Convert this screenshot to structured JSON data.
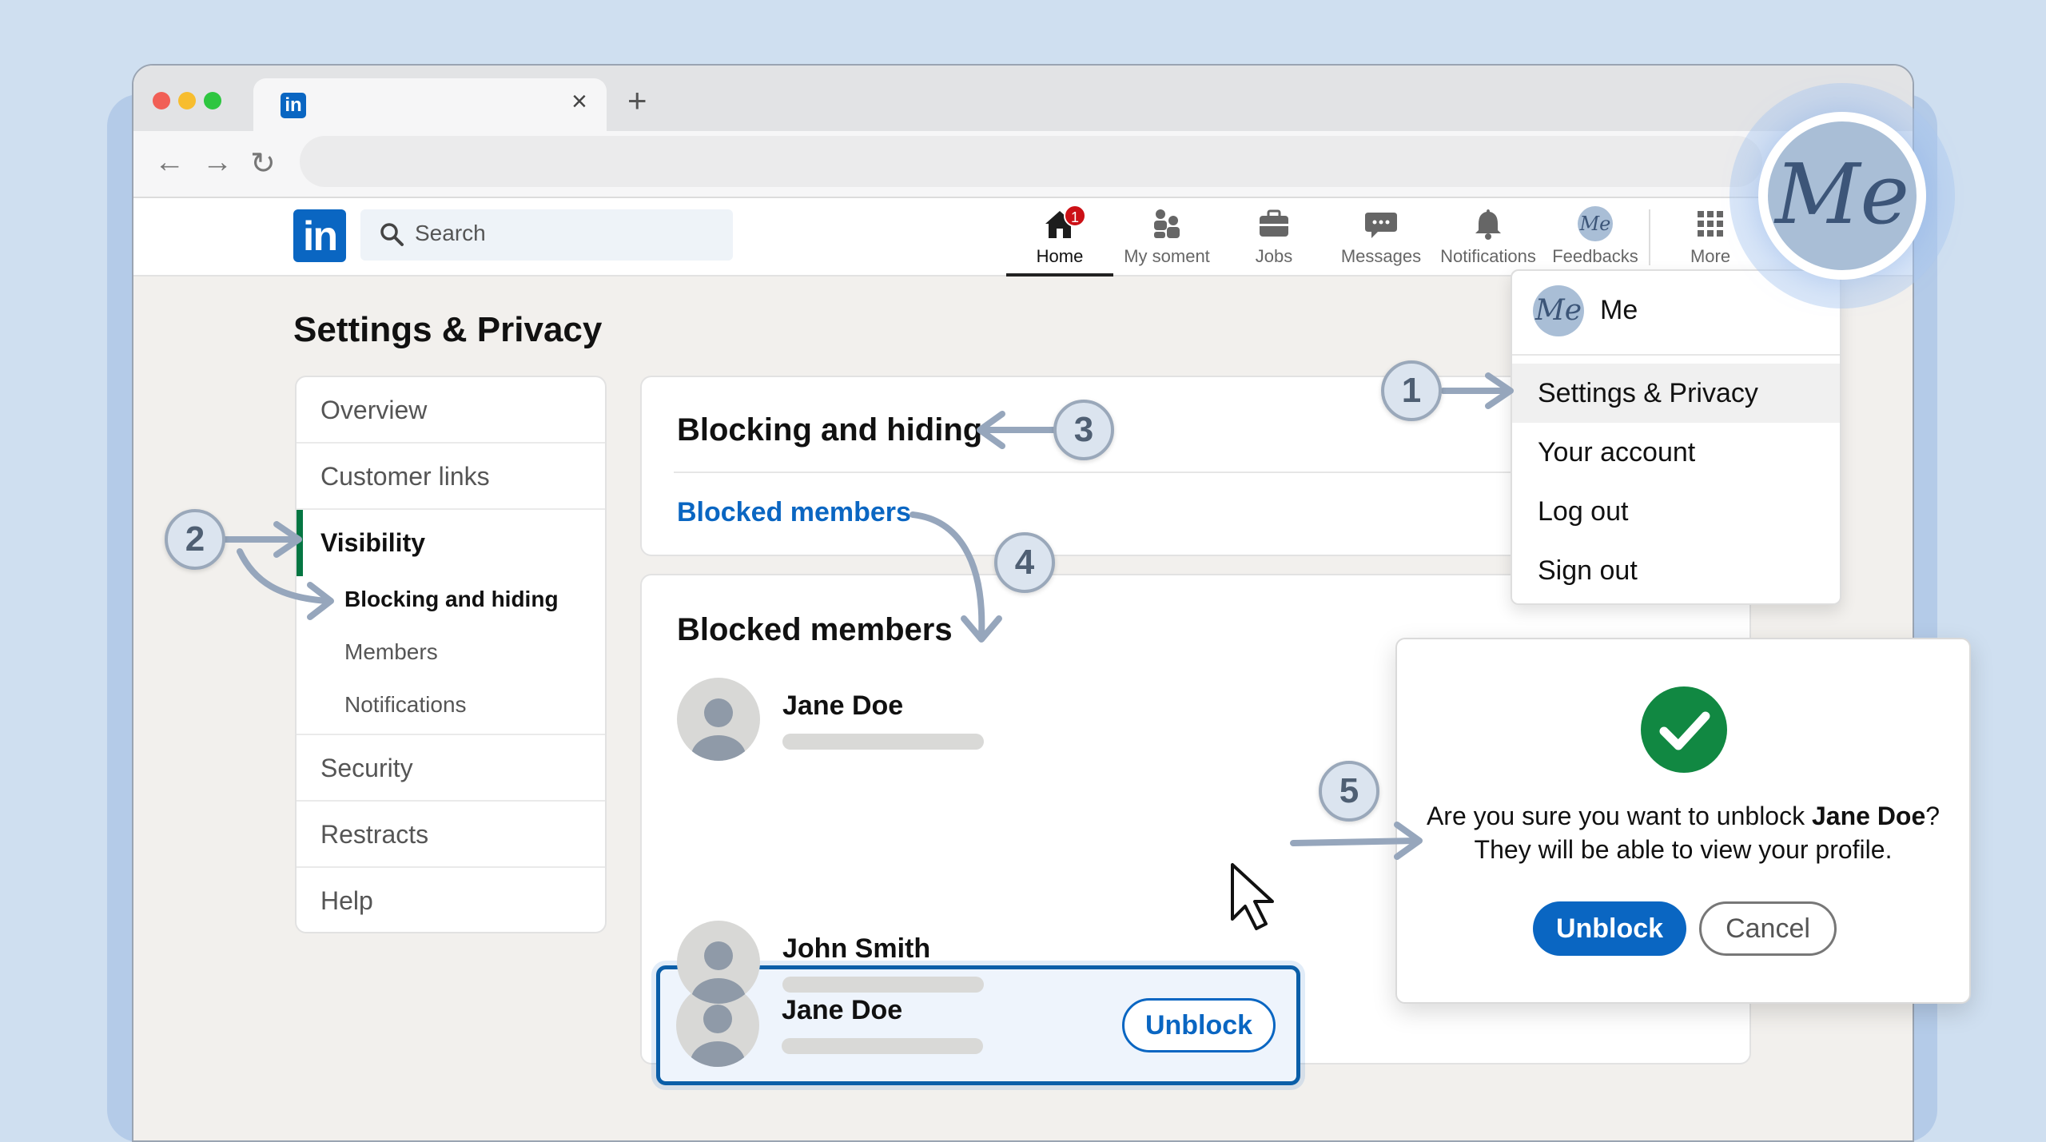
{
  "browser": {
    "tab_favicon": "in",
    "tab_close": "×",
    "new_tab": "+",
    "nav_back": "←",
    "nav_forward": "→",
    "nav_reload": "↻"
  },
  "linkedin": {
    "logo": "in",
    "search_placeholder": "Search",
    "nav": [
      {
        "label": "Home",
        "icon": "home-icon",
        "badge": "1"
      },
      {
        "label": "My soment",
        "icon": "my-network-icon"
      },
      {
        "label": "Jobs",
        "icon": "briefcase-icon"
      },
      {
        "label": "Messages",
        "icon": "message-icon"
      },
      {
        "label": "Notifications",
        "icon": "bell-icon"
      },
      {
        "label": "Feedbacks",
        "icon": "me-avatar-icon",
        "avatar_text": "Me"
      },
      {
        "label": "More",
        "icon": "grid-icon"
      }
    ]
  },
  "page_title": "Settings & Privacy",
  "sidebar": {
    "items": [
      "Overview",
      "Customer links",
      "Visibility",
      "Security",
      "Restracts",
      "Help"
    ],
    "sub_items": [
      "Blocking and hiding",
      "Members",
      "Notifications"
    ]
  },
  "blocking_card": {
    "title": "Blocking and hiding",
    "link": "Blocked members"
  },
  "blocked_card": {
    "title": "Blocked members",
    "members": [
      {
        "name": "Jane Doe"
      },
      {
        "name": "Jane Doe",
        "action": "Unblock"
      },
      {
        "name": "John Smith"
      }
    ]
  },
  "me_menu": {
    "avatar_text": "Me",
    "name": "Me",
    "items": [
      "Settings & Privacy",
      "Your account",
      "Log out",
      "Sign out"
    ]
  },
  "me_bubble": "Me",
  "modal": {
    "question_prefix": "Are you sure you want to unblock ",
    "question_name": "Jane Doe",
    "question_suffix": "?",
    "line2": "They will be able to view your profile.",
    "confirm": "Unblock",
    "cancel": "Cancel"
  },
  "callouts": [
    "1",
    "2",
    "3",
    "4",
    "5"
  ],
  "colors": {
    "linkedin_blue": "#0a66c2",
    "active_green": "#057642",
    "success_green": "#118842",
    "badge_red": "#cc1016"
  }
}
